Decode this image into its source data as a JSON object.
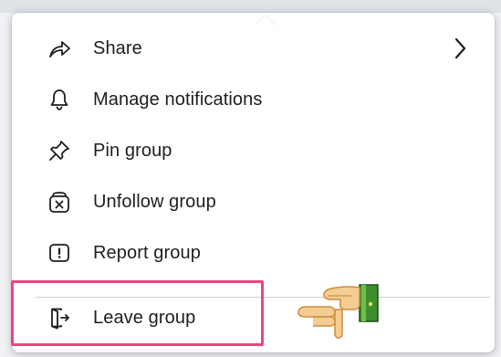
{
  "menu": {
    "items": [
      {
        "label": "Share",
        "icon": "share-icon",
        "has_submenu": true
      },
      {
        "label": "Manage notifications",
        "icon": "bell-icon"
      },
      {
        "label": "Pin group",
        "icon": "pin-icon"
      },
      {
        "label": "Unfollow group",
        "icon": "unfollow-icon"
      },
      {
        "label": "Report group",
        "icon": "report-icon"
      },
      {
        "label": "Leave group",
        "icon": "leave-icon"
      }
    ]
  },
  "annotation": {
    "highlight_color": "#f0457a",
    "pointer_icon": "pointing-hand-icon"
  }
}
